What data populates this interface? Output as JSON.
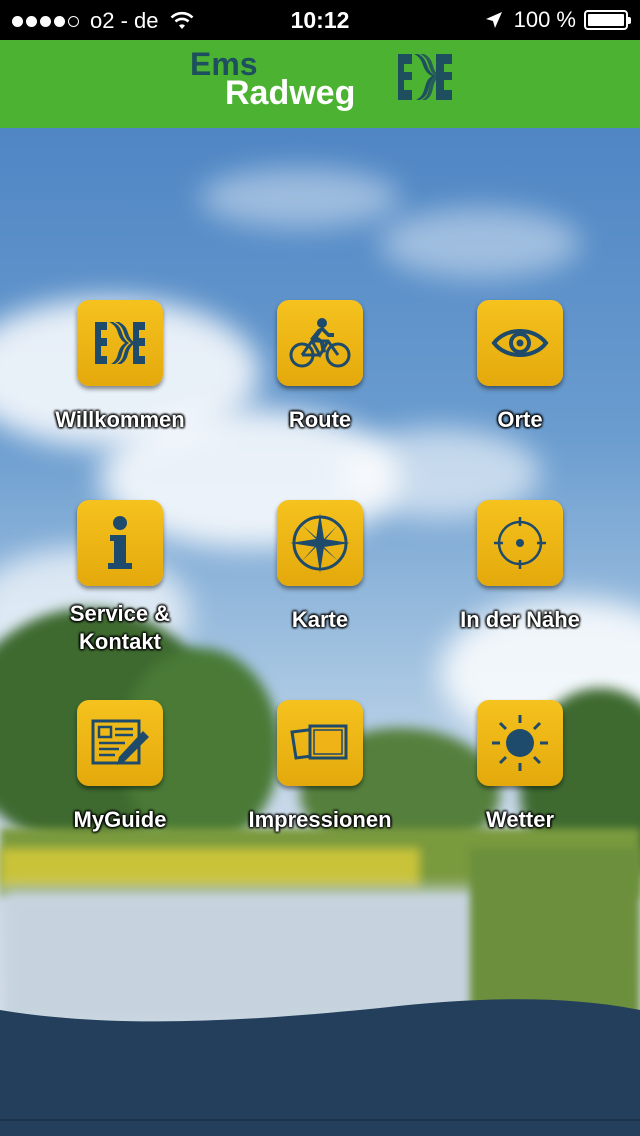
{
  "status_bar": {
    "carrier": "o2 - de",
    "time": "10:12",
    "battery_percent": "100 %",
    "signal_bars_filled": 4,
    "signal_bars_total": 5,
    "icons": [
      "signal-dots-icon",
      "wifi-icon",
      "location-arrow-icon",
      "battery-icon"
    ]
  },
  "header": {
    "logo_line1": "Ems",
    "logo_line2": "Radweg",
    "logo_icon": "ems-radweg-logo-icon",
    "background_color": "#4cb232"
  },
  "menu": {
    "items": [
      {
        "label": "Willkommen",
        "icon": "ems-logo-icon"
      },
      {
        "label": "Route",
        "icon": "cyclist-icon"
      },
      {
        "label": "Orte",
        "icon": "eye-icon"
      },
      {
        "label": "Service &",
        "label2": "Kontakt",
        "icon": "info-icon"
      },
      {
        "label": "Karte",
        "icon": "compass-rose-icon"
      },
      {
        "label": "In der Nähe",
        "icon": "target-icon"
      },
      {
        "label": "MyGuide",
        "icon": "notepad-pen-icon"
      },
      {
        "label": "Impressionen",
        "icon": "photos-icon"
      },
      {
        "label": "Wetter",
        "icon": "sun-icon"
      }
    ]
  },
  "colors": {
    "tile_yellow": "#f0b818",
    "icon_blue": "#1e4b6b",
    "footer_blue": "#233f5c"
  }
}
